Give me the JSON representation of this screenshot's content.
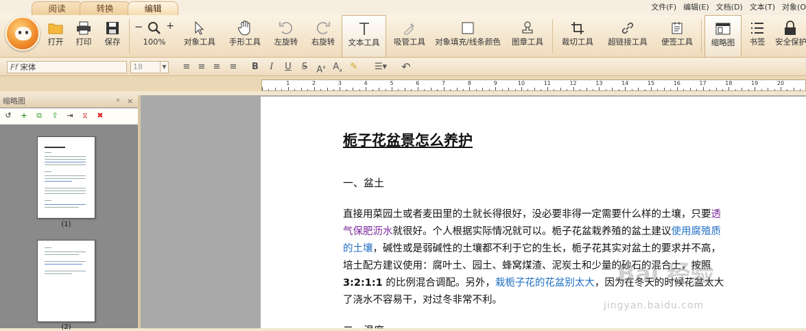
{
  "tabs": [
    {
      "label": "阅读",
      "active": false
    },
    {
      "label": "转换",
      "active": false
    },
    {
      "label": "编辑",
      "active": true
    }
  ],
  "menus": [
    "文件(F)",
    "编辑(E)",
    "文档(D)",
    "文本(T)",
    "对象(O"
  ],
  "toolbar": {
    "open": "打开",
    "print": "打印",
    "save": "保存",
    "zoom_minus": "−",
    "zoom_plus": "+",
    "zoom_level": "100%",
    "object_tool": "对象工具",
    "hand_tool": "手形工具",
    "rotate_left": "左旋转",
    "rotate_right": "右旋转",
    "text_tool": "文本工具",
    "eyedropper": "吸管工具",
    "fill_color": "对象填充/线条颜色",
    "stamp_tool": "图章工具",
    "crop_tool": "裁切工具",
    "link_tool": "超链接工具",
    "note_tool": "便签工具",
    "thumbnail": "缩略图",
    "bookmark": "书签",
    "security": "安全保护"
  },
  "format": {
    "font_name": "宋体",
    "font_size": "18"
  },
  "ruler": {
    "numbers": [
      "1",
      "2",
      "3",
      "4",
      "5",
      "6",
      "7",
      "8",
      "9",
      "10",
      "11",
      "12",
      "13",
      "14",
      "15",
      "16",
      "17",
      "18",
      "19",
      "20"
    ]
  },
  "panel": {
    "title": "缩略图",
    "pin": "ᵖ",
    "close": "×",
    "thumbs": [
      {
        "label": "(1)"
      },
      {
        "label": "(2)"
      }
    ]
  },
  "document": {
    "title": "栀子花盆景怎么养护",
    "section1": "一、盆土",
    "p_1": "直接用菜园土或者麦田里的土就长得很好，没必要非得一定需要什么样的土壤，只要",
    "p_link1": "透气保肥沥水",
    "p_2": "就很好。个人根据实际情况就可以。栀子花盆栽养殖的盆土建议",
    "p_link2": "使用腐殖质的土壤",
    "p_3": "，碱性或是弱碱性的土壤都不利于它的生长，栀子花其实对盆土的要求并不高，培土配方建议使用：腐叶土、园土、蜂窝煤渣、泥炭土和少量的砂石的混合土，按照 ",
    "p_ratio": "3:2:1:1",
    "p_4": " 的比例混合调配。另外，",
    "p_link3": "栽栀子花的花盆别太大",
    "p_5": "，因为在冬天的时候花盆太大了浇水不容易干，对过冬非常不利。",
    "section2": "二、温度"
  },
  "watermark": {
    "text": "Bai 经验",
    "url": "jingyan.baidu.com"
  }
}
